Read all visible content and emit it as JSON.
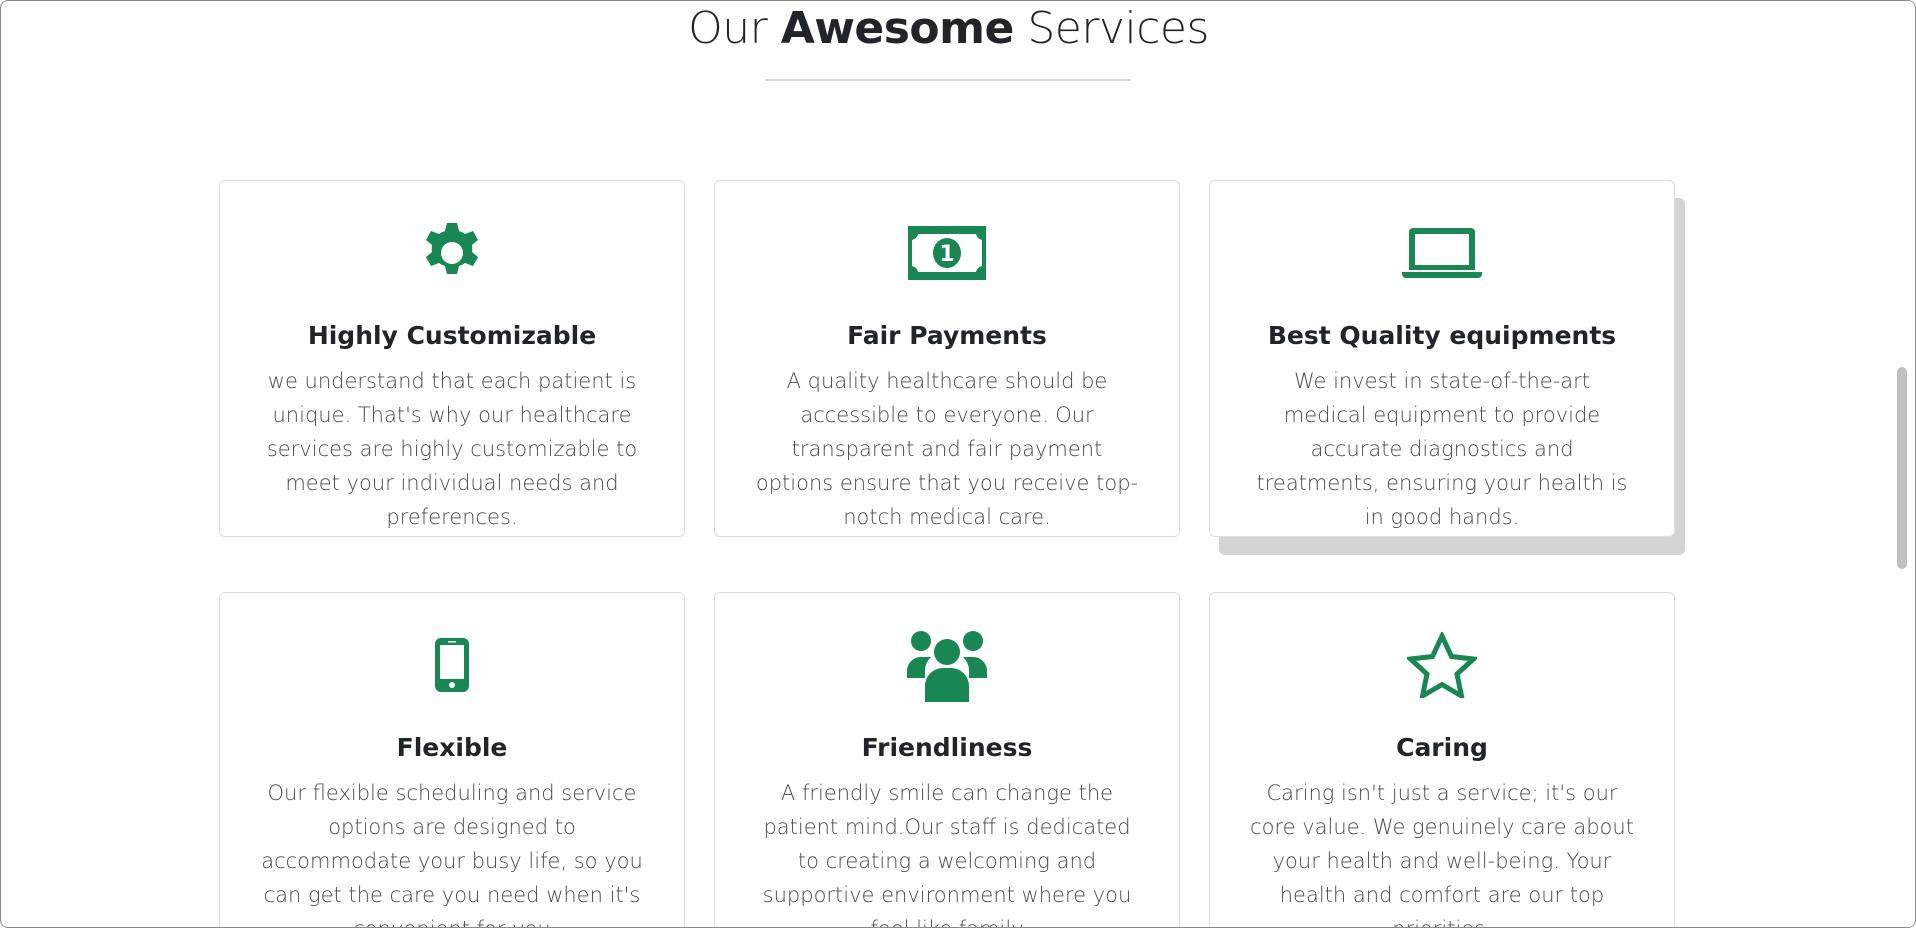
{
  "section": {
    "title_part1": "Our ",
    "title_strong": "Awesome",
    "title_part2": " Services"
  },
  "accent_color": "#198754",
  "services": [
    {
      "icon": "gear-icon",
      "title": "Highly Customizable",
      "text": "we understand that each patient is unique. That's why our healthcare services are highly customizable to meet your individual needs and preferences."
    },
    {
      "icon": "cash-icon",
      "title": "Fair Payments",
      "text": "A quality healthcare should be accessible to everyone. Our transparent and fair payment options ensure that you receive top-notch medical care."
    },
    {
      "icon": "laptop-icon",
      "title": "Best Quality equipments",
      "text": "We invest in state-of-the-art medical equipment to provide accurate diagnostics and treatments, ensuring your health is in good hands."
    },
    {
      "icon": "phone-icon",
      "title": "Flexible",
      "text": "Our flexible scheduling and service options are designed to accommodate your busy life, so you can get the care you need when it's convenient for you"
    },
    {
      "icon": "people-icon",
      "title": "Friendliness",
      "text": "A friendly smile can change the patient mind.Our staff is dedicated to creating a welcoming and supportive environment where you feel like family"
    },
    {
      "icon": "star-icon",
      "title": "Caring",
      "text": "Caring isn't just a service; it's our core value. We genuinely care about your health and well-being. Your health and comfort are our top priorities."
    }
  ]
}
